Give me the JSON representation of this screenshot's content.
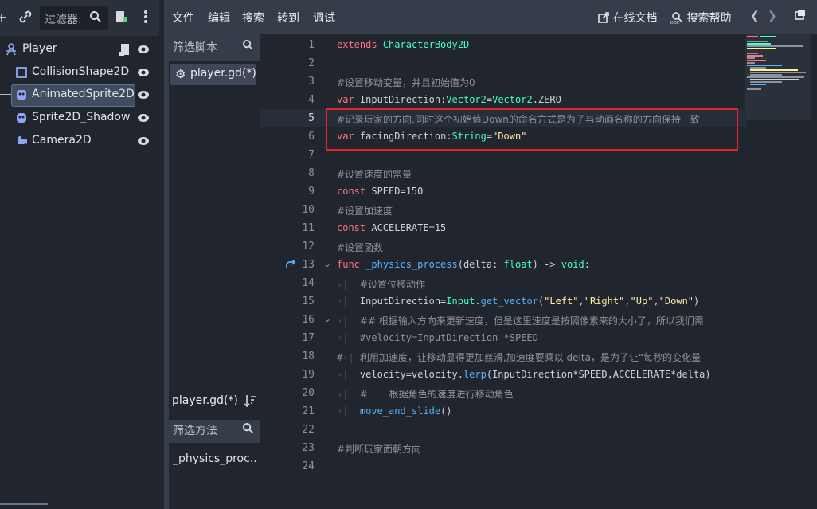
{
  "scene_dock": {
    "filter_placeholder": "过滤器:",
    "nodes": [
      {
        "label": "Player"
      },
      {
        "label": "CollisionShape2D"
      },
      {
        "label": "AnimatedSprite2D"
      },
      {
        "label": "Sprite2D_Shadow"
      },
      {
        "label": "Camera2D"
      }
    ]
  },
  "menubar": {
    "items": [
      "文件",
      "编辑",
      "搜索",
      "转到",
      "调试"
    ],
    "online_docs": "在线文档",
    "search_help": "搜索帮助"
  },
  "script_panel": {
    "filter_scripts": "筛选脚本",
    "scripts": [
      "player.gd(*)"
    ],
    "current_script": "player.gd(*)",
    "filter_methods": "筛选方法",
    "methods": [
      "_physics_proc..."
    ]
  },
  "code_lines": [
    {
      "n": "1"
    },
    {
      "n": "2"
    },
    {
      "n": "3"
    },
    {
      "n": "4"
    },
    {
      "n": "5"
    },
    {
      "n": "6"
    },
    {
      "n": "7"
    },
    {
      "n": "8"
    },
    {
      "n": "9"
    },
    {
      "n": "10"
    },
    {
      "n": "11"
    },
    {
      "n": "12"
    },
    {
      "n": "13"
    },
    {
      "n": "14"
    },
    {
      "n": "15"
    },
    {
      "n": "16"
    },
    {
      "n": "17"
    },
    {
      "n": "18"
    },
    {
      "n": "19"
    },
    {
      "n": "20"
    },
    {
      "n": "21"
    },
    {
      "n": "22"
    },
    {
      "n": "23"
    },
    {
      "n": "24"
    }
  ],
  "code": {
    "l1_kw": "extends",
    "l1_type": "CharacterBody2D",
    "l3": "#设置移动变量，并且初始值为0",
    "l4_kw": "var",
    "l4_name": "InputDirection:",
    "l4_type": "Vector2",
    "l4_eq": "=",
    "l4_type2": "Vector2",
    "l4_rest": ".ZERO",
    "l5": "#记录玩家的方向,同时这个初始值Down的命名方式是为了与动画名称的方向保持一致",
    "l6_kw": "var",
    "l6_name": "facingDirection:",
    "l6_type": "String",
    "l6_eq": "=",
    "l6_str": "\"Down\"",
    "l8": "#设置速度的常量",
    "l9_kw": "const",
    "l9_rest": "SPEED=150",
    "l10": "#设置加速度",
    "l11_kw": "const",
    "l11_rest": "ACCELERATE=15",
    "l12": "#设置函数",
    "l13_kw": "func",
    "l13_fn": "_physics_process",
    "l13_a": "(delta: ",
    "l13_type": "float",
    "l13_b": ") -> ",
    "l13_type2": "void",
    "l13_c": ":",
    "l14": "#设置位移动作",
    "l15_a": "InputDirection=",
    "l15_type": "Input",
    "l15_dot": ".",
    "l15_fn": "get_vector",
    "l15_open": "(",
    "l15_s1": "\"Left\"",
    "l15_c1": ",",
    "l15_s2": "\"Right\"",
    "l15_c2": ",",
    "l15_s3": "\"Up\"",
    "l15_c3": ",",
    "l15_s4": "\"Down\"",
    "l15_close": ")",
    "l16": "## 根据输入方向来更新速度，但是这里速度是按照像素来的大小了，所以我们需",
    "l17": "#velocity=InputDirection *SPEED",
    "l18_hash": "#",
    "l18": "利用加速度，让移动显得更加丝滑,加速度要乘以 delta，是为了让“每秒的变化量",
    "l19_a": "velocity=velocity.",
    "l19_fn": "lerp",
    "l19_b": "(InputDirection*SPEED,ACCELERATE*delta)",
    "l20": "#       根据角色的速度进行移动角色",
    "l21_fn": "move_and_slide",
    "l21_b": "()",
    "l23": "#判断玩家面朝方向"
  }
}
